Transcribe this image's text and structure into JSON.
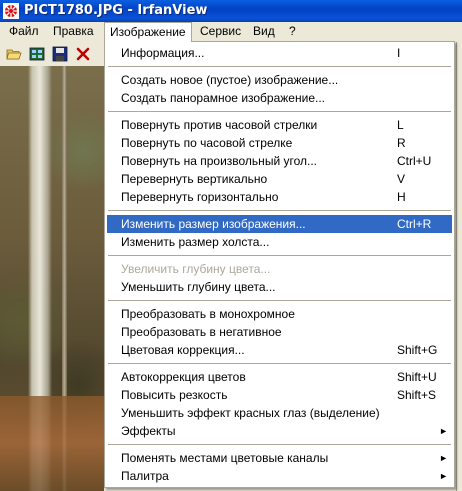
{
  "window": {
    "title": "PICT1780.JPG - IrfanView"
  },
  "menubar": {
    "items": [
      "Файл",
      "Правка",
      "Изображение",
      "Сервис",
      "Вид",
      "?"
    ]
  },
  "toolbar": {
    "icons": [
      "open-folder-icon",
      "thumbnails-icon",
      "save-icon",
      "delete-icon"
    ]
  },
  "menu": {
    "items": [
      {
        "label": "Информация...",
        "shortcut": "I"
      },
      {
        "label": "Создать новое (пустое) изображение...",
        "shortcut": ""
      },
      {
        "label": "Создать панорамное изображение...",
        "shortcut": ""
      },
      {
        "label": "Повернуть против часовой стрелки",
        "shortcut": "L"
      },
      {
        "label": "Повернуть по часовой стрелке",
        "shortcut": "R"
      },
      {
        "label": "Повернуть на произвольный угол...",
        "shortcut": "Ctrl+U"
      },
      {
        "label": "Перевернуть вертикально",
        "shortcut": "V"
      },
      {
        "label": "Перевернуть горизонтально",
        "shortcut": "H"
      },
      {
        "label": "Изменить размер изображения...",
        "shortcut": "Ctrl+R",
        "highlighted": true
      },
      {
        "label": "Изменить размер холста...",
        "shortcut": ""
      },
      {
        "label": "Увеличить глубину цвета...",
        "shortcut": "",
        "disabled": true
      },
      {
        "label": "Уменьшить глубину цвета...",
        "shortcut": ""
      },
      {
        "label": "Преобразовать в монохромное",
        "shortcut": ""
      },
      {
        "label": "Преобразовать в негативное",
        "shortcut": ""
      },
      {
        "label": "Цветовая коррекция...",
        "shortcut": "Shift+G"
      },
      {
        "label": "Автокоррекция цветов",
        "shortcut": "Shift+U"
      },
      {
        "label": "Повысить резкость",
        "shortcut": "Shift+S"
      },
      {
        "label": "Уменьшить эффект красных глаз (выделение)",
        "shortcut": ""
      },
      {
        "label": "Эффекты",
        "shortcut": "",
        "submenu": true
      },
      {
        "label": "Поменять местами цветовые каналы",
        "shortcut": "",
        "submenu": true
      },
      {
        "label": "Палитра",
        "shortcut": "",
        "submenu": true
      }
    ],
    "submenu_arrow": "►"
  }
}
